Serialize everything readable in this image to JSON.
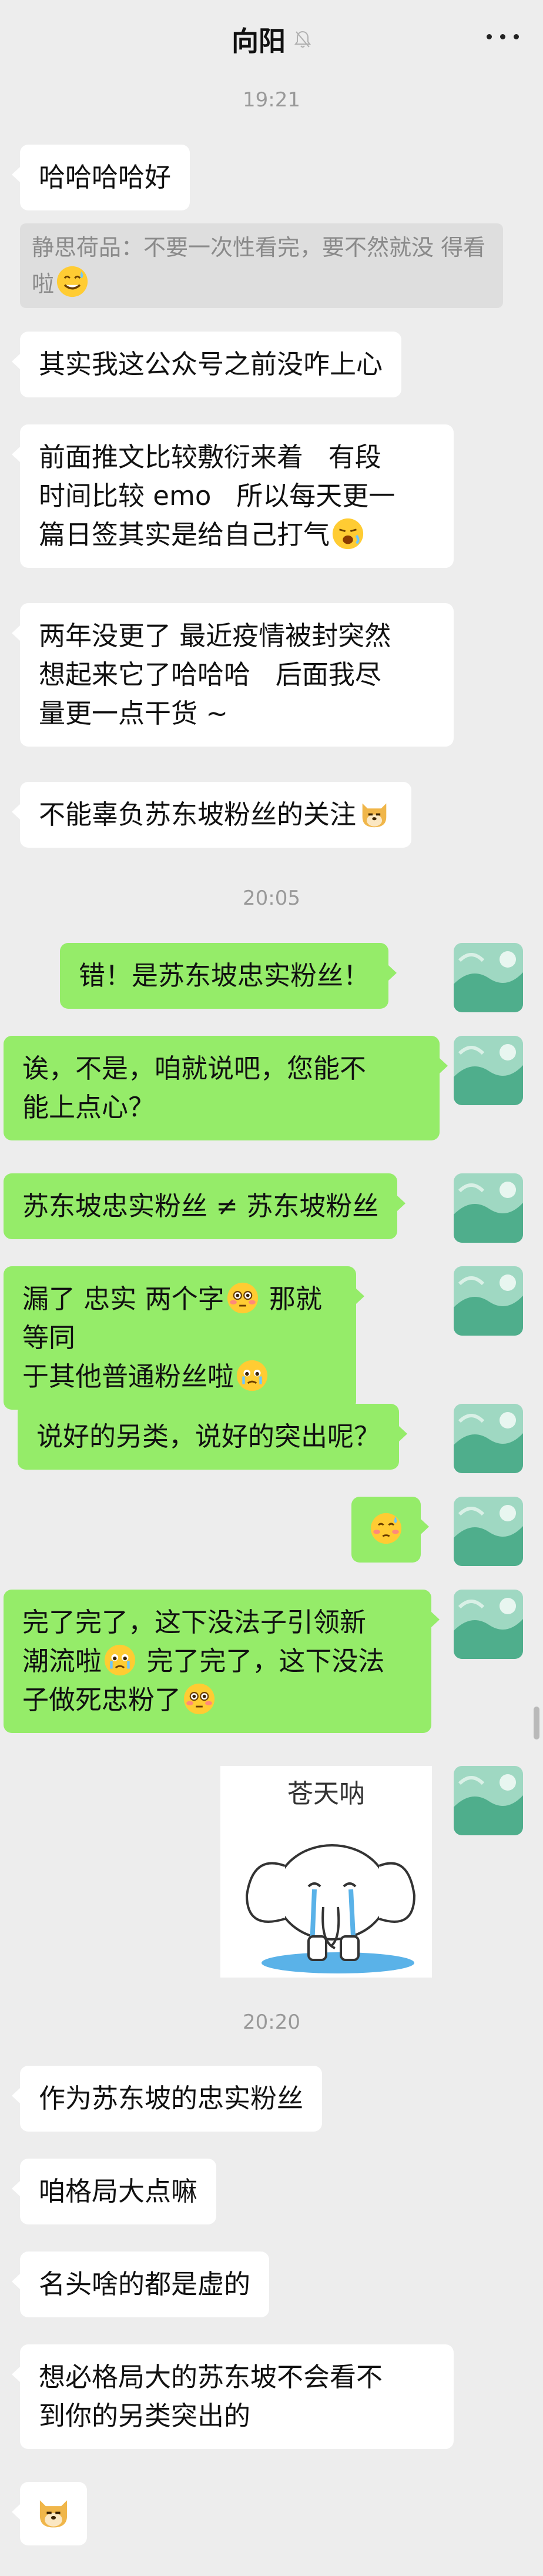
{
  "header": {
    "title": "向阳"
  },
  "timestamps": [
    "19:21",
    "20:05",
    "20:20"
  ],
  "messages": [
    {
      "text": "哈哈哈哈好"
    },
    {
      "text": "静思荷品：不要一次性看完，要不然就没\n得看啦"
    },
    {
      "text": "其实我这公众号之前没咋上心"
    },
    {
      "text": "前面推文比较敷衍来着   有段\n时间比较 emo   所以每天更一\n篇日签其实是给自己打气"
    },
    {
      "text": "两年没更了 最近疫情被封突然\n想起来它了哈哈哈   后面我尽\n量更一点干货 ~"
    },
    {
      "text": "不能辜负苏东坡粉丝的关注"
    },
    {
      "text": "错！是苏东坡忠实粉丝！"
    },
    {
      "text": "诶，不是，咱就说吧，您能不\n能上点心？"
    },
    {
      "text": "苏东坡忠实粉丝 ≠ 苏东坡粉丝"
    },
    {
      "text": "漏了 忠实 两个字",
      "text2": " 那就等同\n于其他普通粉丝啦"
    },
    {
      "text": "说好的另类，说好的突出呢？"
    },
    {
      "text": ""
    },
    {
      "text": "完了完了，这下没法子引领新\n潮流啦",
      "text2": " 完了完了，这下没法\n子做死忠粉了"
    },
    {
      "text": "作为苏东坡的忠实粉丝"
    },
    {
      "text": "咱格局大点嘛"
    },
    {
      "text": "名头啥的都是虚的"
    },
    {
      "text": "想必格局大的苏东坡不会看不\n到你的另类突出的"
    }
  ],
  "sticker": {
    "caption": "苍天呐"
  },
  "colors": {
    "background": "#ededed",
    "left_bubble": "#ffffff",
    "right_bubble": "#95ec69",
    "timestamp": "#999999"
  },
  "icons": {
    "mute": "bell-muted-icon",
    "more": "more-dots-icon",
    "emoji_grin_sweat": "emoji-sweat-smile",
    "emoji_yawn": "emoji-tired",
    "emoji_doge": "emoji-doge",
    "emoji_flushed": "emoji-flushed",
    "emoji_tearful": "emoji-teary",
    "emoji_nervous": "emoji-nervous"
  }
}
